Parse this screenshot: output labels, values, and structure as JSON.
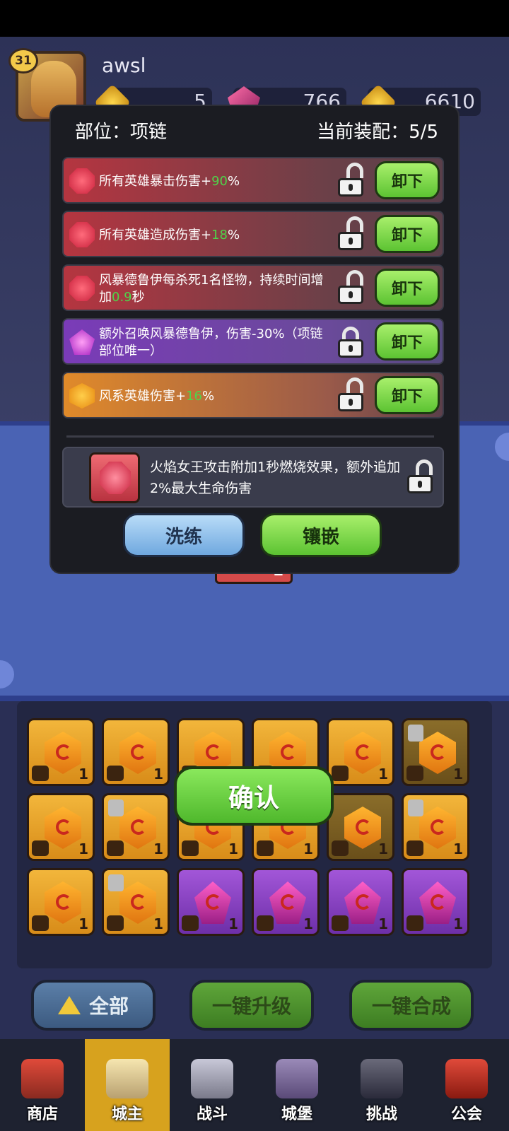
{
  "player": {
    "level": "31",
    "name": "awsl",
    "resources": [
      {
        "icon": "gold-coin-icon",
        "value": "5"
      },
      {
        "icon": "pink-gem-icon",
        "value": "766"
      },
      {
        "icon": "gold-hexagon-icon",
        "value": "6610"
      }
    ]
  },
  "modal": {
    "slot_label": "部位：项链",
    "equipped_label": "当前装配：5/5",
    "rows": [
      {
        "color": "red",
        "icon": "red-gem-icon",
        "text_before": "所有英雄暴击伤害+",
        "highlight": "90",
        "text_after": "%",
        "locked": false,
        "button": "卸下"
      },
      {
        "color": "red",
        "icon": "red-gem-icon",
        "text_before": "所有英雄造成伤害+",
        "highlight": "18",
        "text_after": "%",
        "locked": false,
        "button": "卸下"
      },
      {
        "color": "red",
        "icon": "red-swirl-gem-icon",
        "text_before": "风暴德鲁伊每杀死1名怪物，持续时间增加",
        "highlight": "0.9",
        "text_after": "秒",
        "locked": false,
        "button": "卸下"
      },
      {
        "color": "purple",
        "icon": "purple-gem-icon",
        "text_before": "额外召唤风暴德鲁伊，伤害-30%（项链部位唯一）",
        "highlight": "",
        "text_after": "",
        "locked": true,
        "button": "卸下"
      },
      {
        "color": "orange",
        "icon": "orange-gem-icon",
        "text_before": "风系英雄伤害+",
        "highlight": "16",
        "text_after": "%",
        "locked": false,
        "button": "卸下"
      }
    ],
    "candidate": {
      "text": "火焰女王攻击附加1秒燃烧效果，额外追加2%最大生命伤害",
      "locked": false
    },
    "buttons": {
      "refine": "洗练",
      "inlay": "镶嵌"
    }
  },
  "under_modal_count": "1",
  "confirm_label": "确认",
  "actions": {
    "all": "全部",
    "upgrade_all": "一键升级",
    "merge_all": "一键合成"
  },
  "grid_counts": [
    "1",
    "1",
    "1",
    "1",
    "1",
    "1",
    "1",
    "1",
    "1",
    "1",
    "1",
    "1",
    "1",
    "1",
    "1",
    "1",
    "1",
    "1"
  ],
  "nav": [
    {
      "label": "商店",
      "icon": "shop-icon",
      "active": false
    },
    {
      "label": "城主",
      "icon": "crown-icon",
      "active": true
    },
    {
      "label": "战斗",
      "icon": "swords-icon",
      "active": false
    },
    {
      "label": "城堡",
      "icon": "castle-icon",
      "active": false
    },
    {
      "label": "挑战",
      "icon": "challenge-icon",
      "active": false
    },
    {
      "label": "公会",
      "icon": "guild-banner-icon",
      "active": false
    }
  ]
}
